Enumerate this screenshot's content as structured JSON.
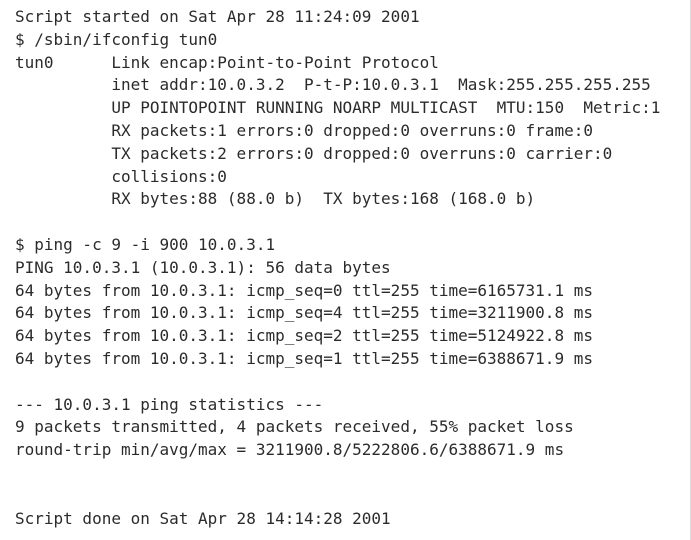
{
  "session": {
    "started": "Script started on Sat Apr 28 11:24:09 2001",
    "done": "Script done on Sat Apr 28 14:14:28 2001"
  },
  "ifconfig": {
    "command": "$ /sbin/ifconfig tun0",
    "lines": [
      "tun0      Link encap:Point-to-Point Protocol",
      "          inet addr:10.0.3.2  P-t-P:10.0.3.1  Mask:255.255.255.255",
      "          UP POINTOPOINT RUNNING NOARP MULTICAST  MTU:150  Metric:1",
      "          RX packets:1 errors:0 dropped:0 overruns:0 frame:0",
      "          TX packets:2 errors:0 dropped:0 overruns:0 carrier:0",
      "          collisions:0",
      "          RX bytes:88 (88.0 b)  TX bytes:168 (168.0 b)"
    ]
  },
  "ping": {
    "command": "$ ping -c 9 -i 900 10.0.3.1",
    "header": "PING 10.0.3.1 (10.0.3.1): 56 data bytes",
    "replies": [
      "64 bytes from 10.0.3.1: icmp_seq=0 ttl=255 time=6165731.1 ms",
      "64 bytes from 10.0.3.1: icmp_seq=4 ttl=255 time=3211900.8 ms",
      "64 bytes from 10.0.3.1: icmp_seq=2 ttl=255 time=5124922.8 ms",
      "64 bytes from 10.0.3.1: icmp_seq=1 ttl=255 time=6388671.9 ms"
    ],
    "stats_title": "--- 10.0.3.1 ping statistics ---",
    "stats_summary": "9 packets transmitted, 4 packets received, 55% packet loss",
    "stats_roundtrip": "round-trip min/avg/max = 3211900.8/5222806.6/6388671.9 ms"
  }
}
